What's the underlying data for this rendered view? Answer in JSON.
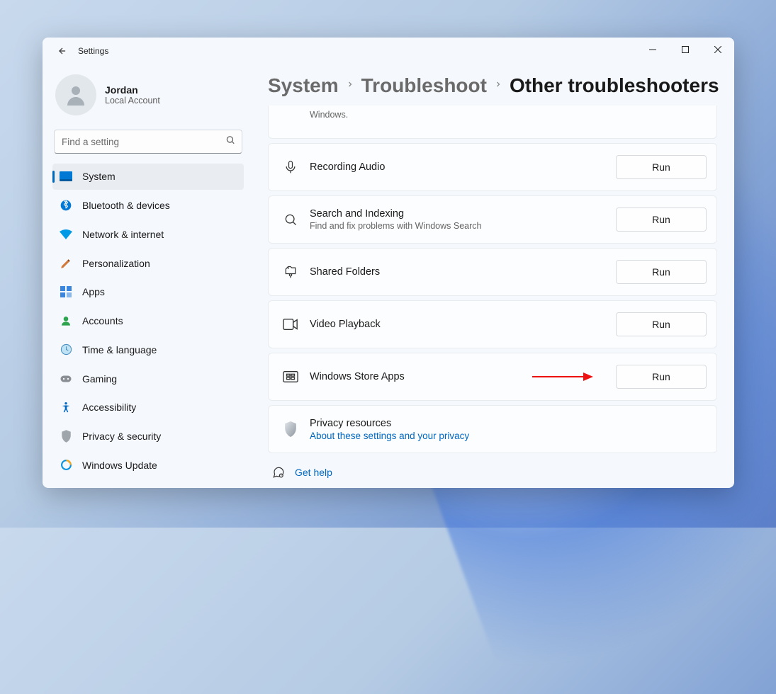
{
  "window": {
    "app_title": "Settings"
  },
  "profile": {
    "name": "Jordan",
    "sub": "Local Account"
  },
  "search": {
    "placeholder": "Find a setting"
  },
  "sidebar": {
    "items": [
      {
        "label": "System"
      },
      {
        "label": "Bluetooth & devices"
      },
      {
        "label": "Network & internet"
      },
      {
        "label": "Personalization"
      },
      {
        "label": "Apps"
      },
      {
        "label": "Accounts"
      },
      {
        "label": "Time & language"
      },
      {
        "label": "Gaming"
      },
      {
        "label": "Accessibility"
      },
      {
        "label": "Privacy & security"
      },
      {
        "label": "Windows Update"
      }
    ]
  },
  "breadcrumb": {
    "root": "System",
    "parent": "Troubleshoot",
    "current": "Other troubleshooters"
  },
  "troubleshooters": {
    "top_partial_sub": "Windows.",
    "recording_audio": "Recording Audio",
    "search_indexing": "Search and Indexing",
    "search_indexing_sub": "Find and fix problems with Windows Search",
    "shared_folders": "Shared Folders",
    "video_playback": "Video Playback",
    "windows_store_apps": "Windows Store Apps",
    "privacy_title": "Privacy resources",
    "privacy_link": "About these settings and your privacy",
    "run_label": "Run"
  },
  "help": {
    "label": "Get help"
  }
}
